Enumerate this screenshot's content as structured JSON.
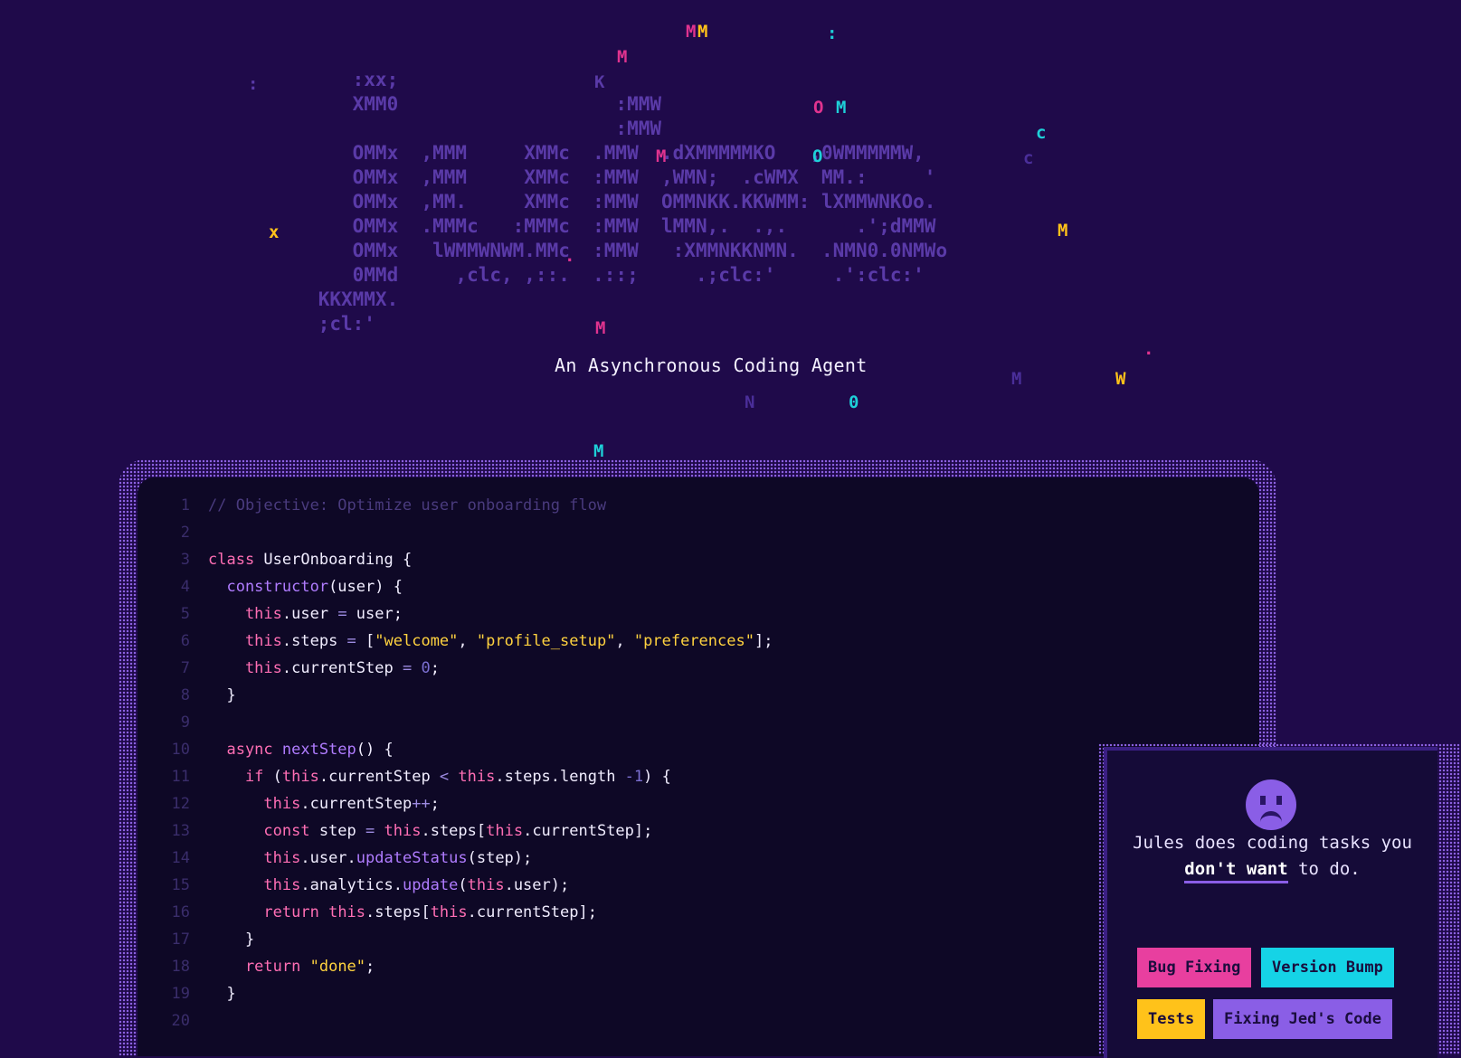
{
  "tagline": "An Asynchronous Coding Agent",
  "logo_ascii": [
    "               :xx;                 ",
    "               XMM0                   :MMW",
    "                                      :MMW",
    "               OMMx  ,MMM     XMMc  .MMW  .dXMMMMMKO   ,0WMMMMMW,",
    "               OMMx  ,MMM     XMMc  :MMW  ,WMN;  .cWMX  MM.:     '",
    "               OMMx  ,MM.     XMMc  :MMW  OMMNKK.KKWMM: lXMMWNKOo.",
    "               OMMx  .MMMc   :MMMc  :MMW  lMMN,.  .,.      .';dMMW",
    "               OMMx   lWMMWNWM.MMc  :MMW   :XMMNKKNMN.  .NMN0.0NMWo",
    "               0MMd     ,clc, ,::.  .::;     .;clc:'     .':clc:'",
    "            KKXMMX.",
    "            ;cl:'"
  ],
  "sparkles": [
    {
      "char": "M",
      "color": "#e0338f"
    },
    {
      "char": "M",
      "color": "#ffc21a"
    },
    {
      "char": ":",
      "color": "#1ed0d8"
    },
    {
      "char": "M",
      "color": "#e0338f"
    },
    {
      "char": ":",
      "color": "#5a3aa8"
    },
    {
      "char": "K",
      "color": "#5a3aa8"
    },
    {
      "char": "O",
      "color": "#e0338f"
    },
    {
      "char": "M",
      "color": "#1ed0d8"
    },
    {
      "char": "c",
      "color": "#1ed0d8"
    },
    {
      "char": "c",
      "color": "#4a2e99"
    },
    {
      "char": "x",
      "color": "#ffc21a"
    },
    {
      "char": "M",
      "color": "#ffc21a"
    },
    {
      "char": "M",
      "color": "#e0338f"
    },
    {
      "char": "·",
      "color": "#e0338f"
    },
    {
      "char": "M",
      "color": "#4a2e99"
    },
    {
      "char": "W",
      "color": "#ffc21a"
    },
    {
      "char": "N",
      "color": "#4a2e99"
    },
    {
      "char": "0",
      "color": "#1ed0d8"
    },
    {
      "char": "M",
      "color": "#1ed0d8"
    },
    {
      "char": "O",
      "color": "#1ed0d8"
    },
    {
      "char": "M",
      "color": "#e0338f"
    },
    {
      "char": ".",
      "color": "#e0338f"
    }
  ],
  "code": {
    "line_numbers": [
      "1",
      "2",
      "3",
      "4",
      "5",
      "6",
      "7",
      "8",
      "9",
      "10",
      "11",
      "12",
      "13",
      "14",
      "15",
      "16",
      "17",
      "18",
      "19",
      "20"
    ],
    "lines": [
      [
        {
          "t": "// Objective: Optimize user onboarding flow",
          "c": "comment"
        }
      ],
      [],
      [
        {
          "t": "class",
          "c": "kw"
        },
        {
          "t": " UserOnboarding {",
          "c": ""
        }
      ],
      [
        {
          "t": "  constructor",
          "c": "fn"
        },
        {
          "t": "(user) {",
          "c": ""
        }
      ],
      [
        {
          "t": "    this",
          "c": "kw"
        },
        {
          "t": ".user ",
          "c": ""
        },
        {
          "t": "=",
          "c": "op"
        },
        {
          "t": " user;",
          "c": ""
        }
      ],
      [
        {
          "t": "    this",
          "c": "kw"
        },
        {
          "t": ".steps ",
          "c": ""
        },
        {
          "t": "=",
          "c": "op"
        },
        {
          "t": " [",
          "c": ""
        },
        {
          "t": "\"welcome\"",
          "c": "str"
        },
        {
          "t": ", ",
          "c": ""
        },
        {
          "t": "\"profile_setup\"",
          "c": "str"
        },
        {
          "t": ", ",
          "c": ""
        },
        {
          "t": "\"preferences\"",
          "c": "str"
        },
        {
          "t": "];",
          "c": ""
        }
      ],
      [
        {
          "t": "    this",
          "c": "kw"
        },
        {
          "t": ".currentStep ",
          "c": ""
        },
        {
          "t": "=",
          "c": "op"
        },
        {
          "t": " ",
          "c": ""
        },
        {
          "t": "0",
          "c": "num"
        },
        {
          "t": ";",
          "c": ""
        }
      ],
      [
        {
          "t": "  }",
          "c": ""
        }
      ],
      [],
      [
        {
          "t": "  async",
          "c": "kw"
        },
        {
          "t": " nextStep",
          "c": "fn"
        },
        {
          "t": "() {",
          "c": ""
        }
      ],
      [
        {
          "t": "    if",
          "c": "kw"
        },
        {
          "t": " (",
          "c": ""
        },
        {
          "t": "this",
          "c": "kw"
        },
        {
          "t": ".currentStep ",
          "c": ""
        },
        {
          "t": "<",
          "c": "op"
        },
        {
          "t": " ",
          "c": ""
        },
        {
          "t": "this",
          "c": "kw"
        },
        {
          "t": ".steps.length ",
          "c": ""
        },
        {
          "t": "-1",
          "c": "num"
        },
        {
          "t": ") {",
          "c": ""
        }
      ],
      [
        {
          "t": "      this",
          "c": "kw"
        },
        {
          "t": ".currentStep",
          "c": ""
        },
        {
          "t": "++",
          "c": "op"
        },
        {
          "t": ";",
          "c": ""
        }
      ],
      [
        {
          "t": "      const",
          "c": "kw"
        },
        {
          "t": " step ",
          "c": ""
        },
        {
          "t": "=",
          "c": "op"
        },
        {
          "t": " ",
          "c": ""
        },
        {
          "t": "this",
          "c": "kw"
        },
        {
          "t": ".steps[",
          "c": ""
        },
        {
          "t": "this",
          "c": "kw"
        },
        {
          "t": ".currentStep];",
          "c": ""
        }
      ],
      [
        {
          "t": "      this",
          "c": "kw"
        },
        {
          "t": ".user.",
          "c": ""
        },
        {
          "t": "updateStatus",
          "c": "fn"
        },
        {
          "t": "(step);",
          "c": ""
        }
      ],
      [
        {
          "t": "      this",
          "c": "kw"
        },
        {
          "t": ".analytics.",
          "c": ""
        },
        {
          "t": "update",
          "c": "fn"
        },
        {
          "t": "(",
          "c": ""
        },
        {
          "t": "this",
          "c": "kw"
        },
        {
          "t": ".user);",
          "c": ""
        }
      ],
      [
        {
          "t": "      return",
          "c": "kw"
        },
        {
          "t": " ",
          "c": ""
        },
        {
          "t": "this",
          "c": "kw"
        },
        {
          "t": ".steps[",
          "c": ""
        },
        {
          "t": "this",
          "c": "kw"
        },
        {
          "t": ".currentStep];",
          "c": ""
        }
      ],
      [
        {
          "t": "    }",
          "c": ""
        }
      ],
      [
        {
          "t": "    return",
          "c": "kw"
        },
        {
          "t": " ",
          "c": ""
        },
        {
          "t": "\"done\"",
          "c": "str"
        },
        {
          "t": ";",
          "c": ""
        }
      ],
      [
        {
          "t": "  }",
          "c": ""
        }
      ],
      []
    ]
  },
  "panel": {
    "icon": "sad-face-icon",
    "text_before": "Jules does coding tasks you",
    "text_emphasis": "don't want",
    "text_after": " to do.",
    "tags": [
      {
        "label": "Bug Fixing",
        "color": "#e83f9f"
      },
      {
        "label": "Version Bump",
        "color": "#15d3e6"
      },
      {
        "label": "Tests",
        "color": "#ffc21a"
      },
      {
        "label": "Fixing Jed's Code",
        "color": "#8a5ee6"
      }
    ]
  }
}
